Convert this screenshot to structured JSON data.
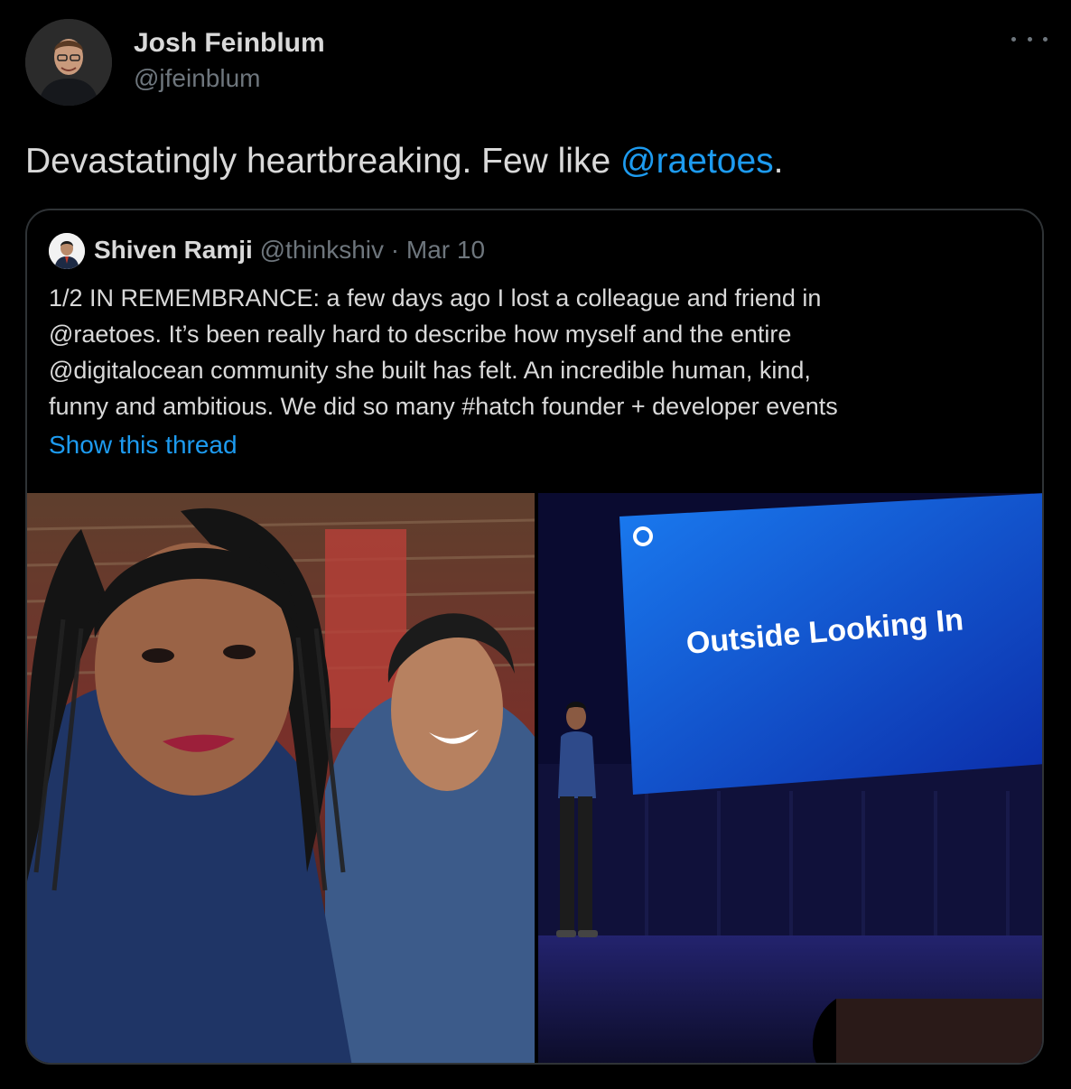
{
  "author": {
    "name": "Josh Feinblum",
    "handle": "@jfeinblum"
  },
  "tweet": {
    "text_before": "Devastatingly heartbreaking. Few like ",
    "mention": "@raetoes",
    "text_after": "."
  },
  "quoted": {
    "name": "Shiven Ramji",
    "handle": "@thinkshiv",
    "separator": " · ",
    "date": "Mar 10",
    "lines": [
      "1/2 IN REMEMBRANCE: a few days ago I lost a colleague and friend in",
      "@raetoes. It’s been really hard to describe how myself and the entire",
      "@digitalocean community she built has felt. An incredible human, kind,",
      "funny and ambitious. We did so many #hatch founder + developer events"
    ],
    "show_thread": "Show this thread",
    "slide_text": "Outside Looking In"
  },
  "icons": {
    "more": "more-horizontal-icon"
  },
  "colors": {
    "background": "#000000",
    "text": "#d9d9d9",
    "secondary": "#6e767d",
    "link": "#1d9bf0",
    "border": "#2f3336"
  }
}
